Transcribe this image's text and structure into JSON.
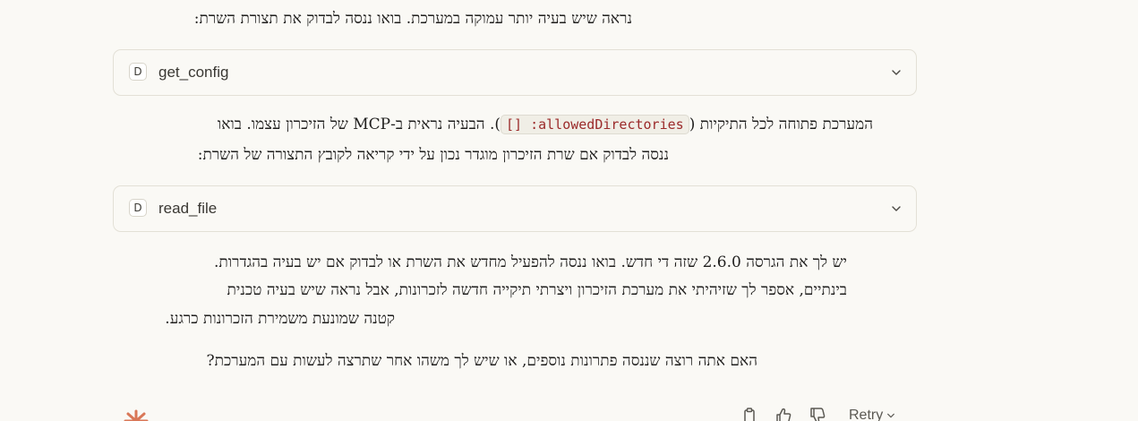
{
  "colors": {
    "background": "#faf9f5",
    "text": "#1f1e1d",
    "card_border": "#e3e0d6",
    "code_text": "#9b2a2a",
    "code_bg": "#f0eee6",
    "logo": "#d97757"
  },
  "messages": {
    "p1": "נראה שיש בעיה יותר עמוקה במערכת. בואו ננסה לבדוק את תצורת השרת:",
    "tool1": {
      "badge": "D",
      "name": "get_config",
      "icon": "chevron-down-icon"
    },
    "p2_line1_start": "המערכת פתוחה לכל התיקיות (",
    "p2_code": "allowedDirectories: []",
    "p2_line1_end": "). הבעיה נראית ב-MCP של הזיכרון עצמו. בואו",
    "p2_line2": "ננסה לבדוק אם שרת הזיכרון מוגדר נכון על ידי קריאה לקובץ התצורה של השרת:",
    "tool2": {
      "badge": "D",
      "name": "read_file",
      "icon": "chevron-down-icon"
    },
    "p3_line1": "יש לך את הגרסה 2.6.0 שזה די חדש. בואו ננסה להפעיל מחדש את השרת או לבדוק אם יש בעיה בהגדרות.",
    "p3_line2": "בינתיים, אספר לך שזיהיתי את מערכת הזיכרון ויצרתי תיקייה חדשה לזכרונות, אבל נראה שיש בעיה טכנית",
    "p3_line3": "קטנה שמונעת משמירת הזכרונות כרגע.",
    "p4": "האם אתה רוצה שננסה פתרונות נוספים, או שיש לך משהו אחר שתרצה לעשות עם המערכת?"
  },
  "actions": {
    "copy_icon": "clipboard-icon",
    "thumbs_up_icon": "thumbs-up-icon",
    "thumbs_down_icon": "thumbs-down-icon",
    "retry_label": "Retry",
    "retry_icon": "chevron-down-icon"
  },
  "logo_icon": "claude-starburst-icon"
}
